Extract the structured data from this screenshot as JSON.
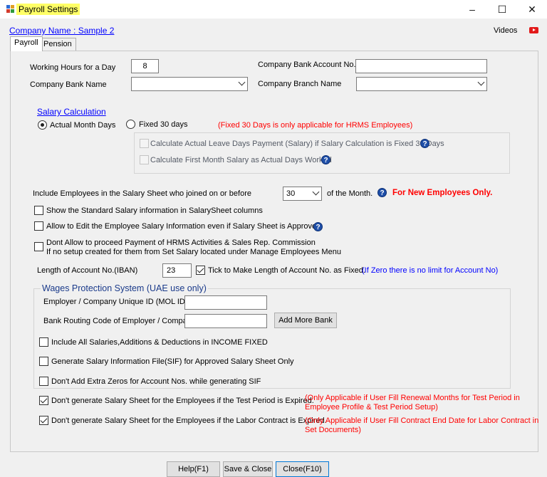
{
  "window": {
    "title": "Payroll Settings",
    "controls": {
      "minimize": "–",
      "maximize": "☐",
      "close": "✕"
    }
  },
  "header": {
    "company_link": "Company Name : Sample 2",
    "videos_label": "Videos",
    "videos_icon": "youtube-icon"
  },
  "tabs": [
    {
      "label": "Payroll",
      "active": true
    },
    {
      "label": "Pension",
      "active": false
    }
  ],
  "bank": {
    "working_hours_label": "Working Hours for a Day",
    "working_hours_value": "8",
    "bank_name_label": "Company Bank Name",
    "bank_name_value": "",
    "account_no_label": "Company Bank Account No.",
    "account_no_value": "",
    "branch_name_label": "Company Branch Name",
    "branch_name_value": ""
  },
  "salary_calc": {
    "title": "Salary Calculation",
    "option_actual": "Actual Month Days",
    "option_fixed": "Fixed 30 days",
    "selected": "Actual Month Days",
    "fixed_note": "(Fixed 30 Days is only applicable for HRMS Employees)",
    "leave_days_label": "Calculate Actual Leave Days Payment (Salary) if Salary Calculation is Fixed 30 Days",
    "first_month_label": "Calculate First Month Salary as Actual Days Worked"
  },
  "options": {
    "include_employees_label": "Include Employees in the Salary Sheet who joined on or before",
    "include_day_value": "30",
    "of_month_label": "of the Month.",
    "new_employees_note": "For New Employees Only.",
    "show_standard_label": "Show the Standard Salary information in SalarySheet columns",
    "allow_edit_label": "Allow to Edit the Employee Salary Information  even if Salary Sheet is Approved",
    "dont_allow_line1": "Dont Allow to proceed Payment of HRMS Activities & Sales Rep. Commission",
    "dont_allow_line2": "If no setup created for them from Set Salary located under Manage Employees Menu",
    "iban_length_label": "Length of Account No.(IBAN)",
    "iban_length_value": "23",
    "iban_fixed_label": "Tick to Make Length of Account No. as Fixed.",
    "iban_fixed_checked": true,
    "iban_note": "(If Zero there is no limit for Account No)"
  },
  "wps": {
    "title": "Wages Protection System (UAE use only)",
    "employer_id_label": "Employer / Company Unique ID (MOL ID)",
    "employer_id_value": "",
    "routing_label": "Bank Routing Code of Employer / Company",
    "routing_value": "",
    "add_bank_button": "Add More Bank",
    "include_all_label": "Include All Salaries,Additions & Deductions in INCOME FIXED",
    "generate_sif_label": "Generate Salary Information File(SIF) for Approved Salary Sheet Only",
    "no_extra_zeros_label": "Don't Add Extra Zeros for Account Nos.  while generating SIF"
  },
  "expiry": {
    "test_period_label": "Don't generate Salary Sheet for the Employees if the Test Period is Expired.",
    "test_period_checked": true,
    "test_period_note_line1": "(Only Applicable if User Fill Renewal Months for Test Period in",
    "test_period_note_line2": "Employee Profile & Test Period Setup)",
    "labor_contract_label": "Don't generate Salary Sheet for the Employees if the Labor Contract is Expired.",
    "labor_contract_checked": true,
    "labor_note_line1": "(Only Applicable if User Fill Contract End Date for Labor Contract in",
    "labor_note_line2": "Set Documents)"
  },
  "footer": {
    "help_button": "Help(F1)",
    "save_button": "Save & Close",
    "close_button": "Close(F10)"
  },
  "colors": {
    "title_highlight": "#ffff66",
    "link": "#0000ff",
    "warning": "#ff0000",
    "help_icon": "#1f4fa8"
  }
}
